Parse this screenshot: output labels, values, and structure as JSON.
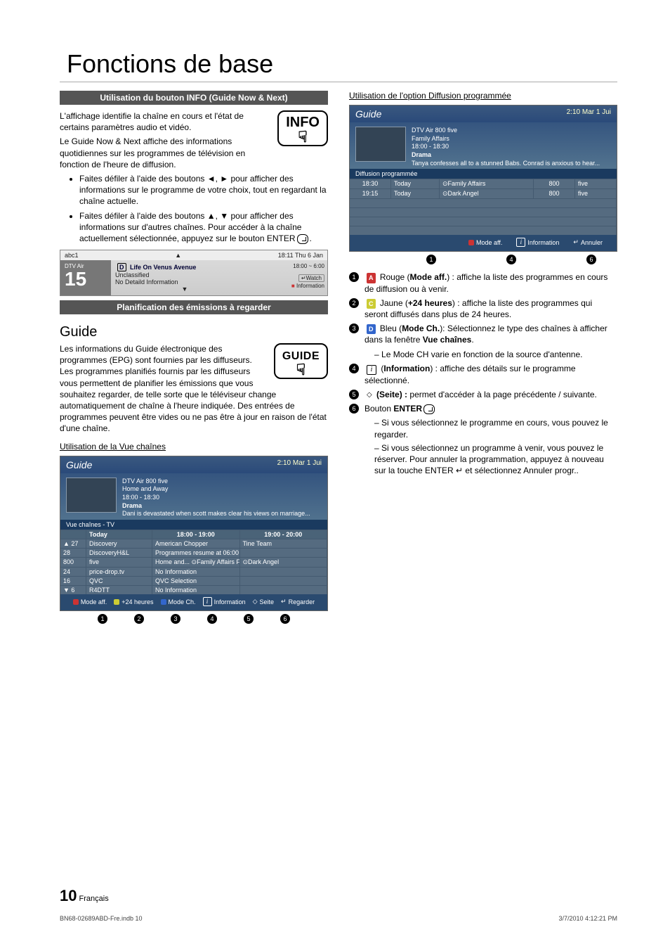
{
  "title": "Fonctions de base",
  "left": {
    "bar1": "Utilisation du bouton INFO (Guide Now & Next)",
    "p1": "L'affichage identifie la chaîne en cours et l'état de certains paramètres audio et vidéo.",
    "p2": "Le Guide Now & Next affiche des informations quotidiennes sur les programmes de télévision en fonction de l'heure de diffusion.",
    "info_label": "INFO",
    "bul1": "Faites défiler à l'aide des boutons ◄, ► pour afficher des informations sur le programme de votre choix, tout en regardant la chaîne actuelle.",
    "bul2": "Faites défiler à l'aide des boutons ▲, ▼ pour afficher des informations sur d'autres chaînes. Pour accéder à la chaîne actuellement sélectionnée, appuyez sur le bouton ENTER",
    "bul2_suffix": ".",
    "nn": {
      "topleft": "abc1",
      "topright": "18:11 Thu 6 Jan",
      "dtv": "DTV Air",
      "num": "15",
      "prog": "Life On Venus Avenue",
      "l2": "Unclassified",
      "l3": "No Detaild Information",
      "time": "18:00 ~ 6:00",
      "watch": "Watch",
      "info": "Information"
    },
    "bar2": "Planification des émissions à regarder",
    "h2": "Guide",
    "guide_p": "Les informations du Guide électronique des programmes (EPG) sont fournies par les diffuseurs. Les programmes planifiés fournis par les diffuseurs vous permettent de planifier les émissions que vous souhaitez regarder, de telle sorte que le téléviseur change automatiquement de chaîne à l'heure indiquée. Des entrées de programmes peuvent être vides ou ne pas être à jour en raison de l'état d'une chaîne.",
    "guide_label": "GUIDE",
    "h3a": "Utilisation de la Vue chaînes",
    "guide1": {
      "title": "Guide",
      "clock": "2:10 Mar 1 Jui",
      "meta1": "DTV Air 800 five",
      "meta2": "Home and Away",
      "meta3": "18:00 - 18:30",
      "meta4": "Drama",
      "meta5": "Dani is devastated when scott makes clear his views on marriage...",
      "tab": "Vue chaînes - TV",
      "head_today": "Today",
      "head_t1": "18:00 - 19:00",
      "head_t2": "19:00 - 20:00",
      "rows": [
        {
          "ch": "▲ 27",
          "name": "Discovery",
          "c1": "American Chopper",
          "c2": "Tine Team"
        },
        {
          "ch": "28",
          "name": "DiscoveryH&L",
          "c1": "Programmes resume at 06:00",
          "c2": ""
        },
        {
          "ch": "800",
          "name": "five",
          "c1": "Home and...    ⊙Family Affairs    Fiv...",
          "c2": "⊙Dark Angel"
        },
        {
          "ch": "24",
          "name": "price-drop.tv",
          "c1": "No Information",
          "c2": ""
        },
        {
          "ch": "16",
          "name": "QVC",
          "c1": "QVC Selection",
          "c2": ""
        },
        {
          "ch": "▼ 6",
          "name": "R4DTT",
          "c1": "No Information",
          "c2": ""
        }
      ],
      "fk": {
        "mode": "Mode aff.",
        "h24": "+24 heures",
        "modech": "Mode Ch.",
        "info": "Information",
        "seite": "Seite",
        "regarder": "Regarder"
      }
    }
  },
  "right": {
    "h3": "Utilisation de l'option Diffusion programmée",
    "guide2": {
      "title": "Guide",
      "clock": "2:10 Mar 1 Jui",
      "meta1": "DTV Air 800 five",
      "meta2": "Family Affairs",
      "meta3": "18:00 - 18:30",
      "meta4": "Drama",
      "meta5": "Tanya confesses all to a stunned Babs. Conrad is anxious to hear...",
      "tab": "Diffusion programmée",
      "rows": [
        {
          "t": "18:30",
          "d": "Today",
          "p": "⊙Family Affairs",
          "ch": "800",
          "src": "five"
        },
        {
          "t": "19:15",
          "d": "Today",
          "p": "⊙Dark Angel",
          "ch": "800",
          "src": "five"
        }
      ],
      "fk": {
        "mode": "Mode aff.",
        "info": "Information",
        "annuler": "Annuler"
      }
    },
    "legend": [
      {
        "n": "1",
        "pre": "Rouge (",
        "bold": "Mode aff.",
        "post": ") : affiche la liste des programmes en cours de diffusion ou à venir.",
        "color": "red",
        "sym": "A"
      },
      {
        "n": "2",
        "pre": "Jaune (",
        "bold": "+24 heures",
        "post": ") : affiche la liste des programmes qui seront diffusés dans plus de 24 heures.",
        "color": "yellow",
        "sym": "C"
      },
      {
        "n": "3",
        "pre": "Bleu (",
        "bold": "Mode Ch.",
        "post": "): Sélectionnez le type des chaînes à afficher dans la fenêtre ",
        "tail_bold": "Vue chaînes",
        "tail": ".",
        "color": "blue",
        "sym": "D",
        "sub": [
          "Le Mode CH varie en fonction de la source d'antenne."
        ]
      },
      {
        "n": "4",
        "sym": "i",
        "pre": "(",
        "bold": "Information",
        "post": ") : affiche des détails sur le programme sélectionné."
      },
      {
        "n": "5",
        "sym": "updown",
        "pre": "",
        "bold": "(Seite) :",
        "post": " permet d'accéder à la page précédente / suivante."
      },
      {
        "n": "6",
        "pre": "Bouton ",
        "bold": "ENTER",
        "post": "",
        "sub": [
          "Si vous sélectionnez le programme en cours, vous pouvez le regarder.",
          "Si vous sélectionnez un programme à venir, vous pouvez le réserver. Pour annuler la programmation, appuyez à nouveau sur la touche ENTER ↵ et sélectionnez Annuler progr.."
        ]
      }
    ]
  },
  "footer": {
    "page": "10",
    "lang": "Français",
    "file": "BN68-02689ABD-Fre.indb   10",
    "ts": "3/7/2010   4:12:21 PM"
  }
}
